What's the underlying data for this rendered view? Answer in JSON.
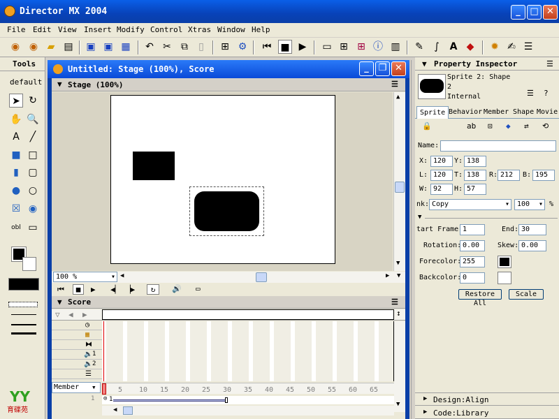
{
  "window": {
    "title": "Director MX 2004"
  },
  "menu": [
    "File",
    "Edit",
    "View",
    "Insert",
    "Modify",
    "Control",
    "Xtras",
    "Window",
    "Help"
  ],
  "tools": {
    "title": "Tools",
    "mode": "default"
  },
  "doc": {
    "title": "Untitled: Stage (100%), Score"
  },
  "stage": {
    "title": "Stage (100%)",
    "zoom": "100 %"
  },
  "score": {
    "title": "Score",
    "display": "Member",
    "channels": [
      "1",
      "2"
    ],
    "frame_ticks": [
      "5",
      "10",
      "15",
      "20",
      "25",
      "30",
      "35",
      "40",
      "45",
      "50",
      "55",
      "60",
      "65"
    ],
    "sprite_label": "1",
    "row_num": "1"
  },
  "pi": {
    "title": "Property Inspector",
    "sprite_name": "Sprite 2: Shape",
    "sprite_num": "2",
    "cast": "Internal",
    "tabs": [
      "Sprite",
      "Behavior",
      "Member",
      "Shape",
      "Movie"
    ],
    "name_label": "Name:",
    "name_value": "",
    "x_label": "X:",
    "x": "120",
    "y_label": "Y:",
    "y": "138",
    "l_label": "L:",
    "l": "120",
    "t_label": "T:",
    "t": "138",
    "r_label": "R:",
    "r": "212",
    "b_label": "B:",
    "b": "195",
    "w_label": "W:",
    "w": "92",
    "h_label": "H:",
    "h": "57",
    "ink_label": "nk:",
    "ink": "Copy",
    "blend": "100",
    "pct": "%",
    "start_label": "tart Frame:",
    "start": "1",
    "end_label": "End:",
    "end": "30",
    "rot_label": "Rotation:",
    "rot": "0.00",
    "skew_label": "Skew:",
    "skew": "0.00",
    "fore_label": "Forecolor:",
    "fore": "255",
    "back_label": "Backcolor:",
    "back": "0",
    "restore": "Restore All",
    "scale": "Scale",
    "design": "Design:Align",
    "code": "Code:Library"
  },
  "logo": "育碟苑"
}
